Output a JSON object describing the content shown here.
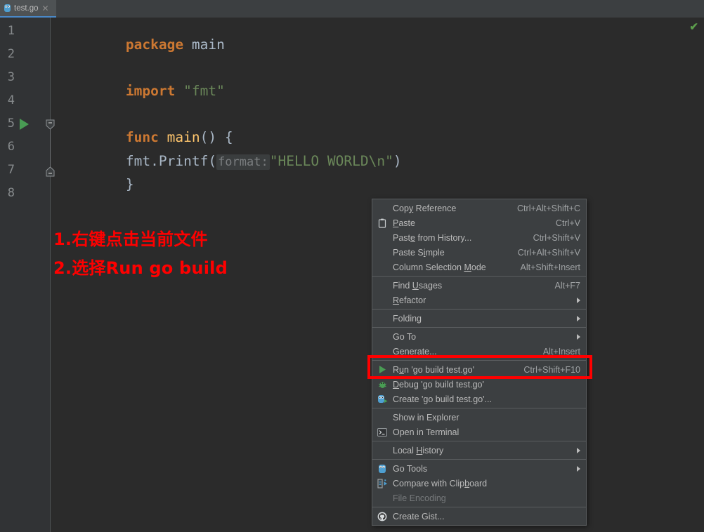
{
  "window": {
    "tab": {
      "label": "test.go",
      "icon": "go-file-icon",
      "close_icon": "close-icon"
    },
    "inspection_indicator": "✔"
  },
  "editor": {
    "line_numbers": [
      "1",
      "2",
      "3",
      "4",
      "5",
      "6",
      "7",
      "8"
    ],
    "code": {
      "l1_kw": "package",
      "l1_id": "main",
      "l3_kw": "import",
      "l3_str": "\"fmt\"",
      "l5_kw": "func",
      "l5_fn": "main",
      "l5_punc": "() {",
      "l6_id": "fmt.Printf(",
      "l6_hint": "format:",
      "l6_str": "\"HELLO WORLD\\n\"",
      "l6_close": ")",
      "l7_punc": "}"
    },
    "run_gutter_icon": "run-triangle-icon"
  },
  "annotation": {
    "line1": "1.右键点击当前文件",
    "line2": "2.选择Run go build",
    "color": "#ff0000"
  },
  "context_menu": {
    "groups": [
      {
        "items": [
          {
            "label": "Copy Reference",
            "mnemonic": "y",
            "accel": "Ctrl+Alt+Shift+C",
            "icon": "",
            "submenu": false,
            "disabled": false
          },
          {
            "label": "Paste",
            "mnemonic": "P",
            "accel": "Ctrl+V",
            "icon": "clipboard-icon",
            "submenu": false,
            "disabled": false
          },
          {
            "label": "Paste from History...",
            "mnemonic": "e",
            "accel": "Ctrl+Shift+V",
            "icon": "",
            "submenu": false,
            "disabled": false
          },
          {
            "label": "Paste Simple",
            "mnemonic": "i",
            "accel": "Ctrl+Alt+Shift+V",
            "icon": "",
            "submenu": false,
            "disabled": false
          },
          {
            "label": "Column Selection Mode",
            "mnemonic": "M",
            "accel": "Alt+Shift+Insert",
            "icon": "",
            "submenu": false,
            "disabled": false
          }
        ]
      },
      {
        "items": [
          {
            "label": "Find Usages",
            "mnemonic": "U",
            "accel": "Alt+F7",
            "icon": "",
            "submenu": false,
            "disabled": false
          },
          {
            "label": "Refactor",
            "mnemonic": "R",
            "accel": "",
            "icon": "",
            "submenu": true,
            "disabled": false
          }
        ]
      },
      {
        "items": [
          {
            "label": "Folding",
            "mnemonic": "",
            "accel": "",
            "icon": "",
            "submenu": true,
            "disabled": false
          }
        ]
      },
      {
        "items": [
          {
            "label": "Go To",
            "mnemonic": "",
            "accel": "",
            "icon": "",
            "submenu": true,
            "disabled": false
          },
          {
            "label": "Generate...",
            "mnemonic": "",
            "accel": "Alt+Insert",
            "icon": "",
            "submenu": false,
            "disabled": false
          }
        ]
      },
      {
        "items": [
          {
            "label": "Run 'go build test.go'",
            "mnemonic": "u",
            "accel": "Ctrl+Shift+F10",
            "icon": "run-green-triangle-icon",
            "submenu": false,
            "disabled": false
          },
          {
            "label": "Debug 'go build test.go'",
            "mnemonic": "D",
            "accel": "",
            "icon": "debug-bug-icon",
            "submenu": false,
            "disabled": false
          },
          {
            "label": "Create 'go build test.go'...",
            "mnemonic": "",
            "accel": "",
            "icon": "go-run-config-icon",
            "submenu": false,
            "disabled": false
          }
        ]
      },
      {
        "items": [
          {
            "label": "Show in Explorer",
            "mnemonic": "",
            "accel": "",
            "icon": "",
            "submenu": false,
            "disabled": false
          },
          {
            "label": "Open in Terminal",
            "mnemonic": "",
            "accel": "",
            "icon": "terminal-icon",
            "submenu": false,
            "disabled": false
          }
        ]
      },
      {
        "items": [
          {
            "label": "Local History",
            "mnemonic": "H",
            "accel": "",
            "icon": "",
            "submenu": true,
            "disabled": false
          }
        ]
      },
      {
        "items": [
          {
            "label": "Go Tools",
            "mnemonic": "",
            "accel": "",
            "icon": "gopher-icon",
            "submenu": true,
            "disabled": false
          },
          {
            "label": "Compare with Clipboard",
            "mnemonic": "b",
            "accel": "",
            "icon": "compare-icon",
            "submenu": false,
            "disabled": false
          },
          {
            "label": "File Encoding",
            "mnemonic": "",
            "accel": "",
            "icon": "",
            "submenu": false,
            "disabled": true
          }
        ]
      },
      {
        "items": [
          {
            "label": "Create Gist...",
            "mnemonic": "",
            "accel": "",
            "icon": "github-icon",
            "submenu": false,
            "disabled": false
          }
        ]
      }
    ]
  },
  "highlight_box": {
    "target": "Run 'go build test.go'",
    "color": "#ff0000"
  }
}
